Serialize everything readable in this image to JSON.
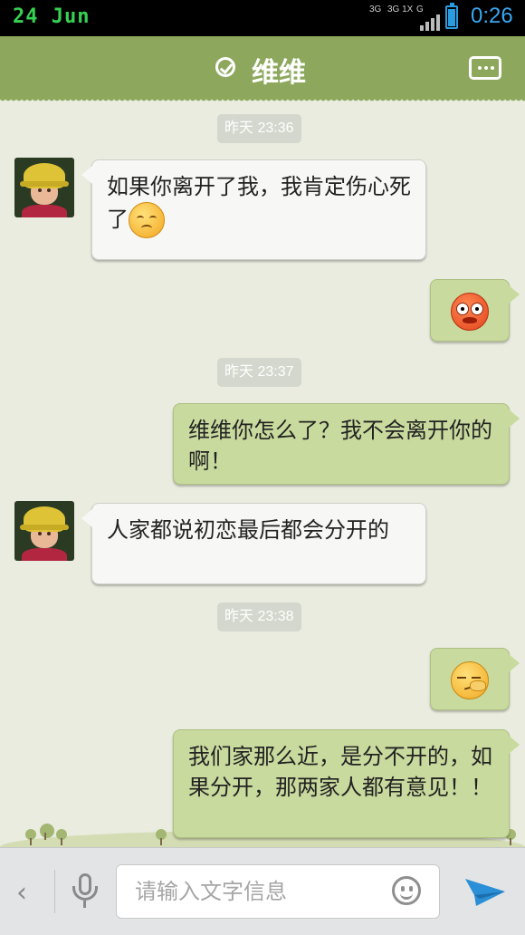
{
  "status_bar": {
    "date": "24 Jun",
    "network_labels": [
      "3G",
      "3G 1X",
      "G"
    ],
    "time": "0:26",
    "battery_level": 0.85
  },
  "header": {
    "title": "维维"
  },
  "timestamps": [
    "昨天 23:36",
    "昨天 23:37",
    "昨天 23:38"
  ],
  "messages": [
    {
      "side": "left",
      "text": "如果你离开了我，我肯定伤心死了",
      "emoji": "sad-face"
    },
    {
      "side": "right",
      "text": "",
      "emoji": "angry-face"
    },
    {
      "side": "right",
      "text": "维维你怎么了？我不会离开你的啊！"
    },
    {
      "side": "left",
      "text": "人家都说初恋最后都会分开的"
    },
    {
      "side": "right",
      "text": "",
      "emoji": "thinking-face"
    },
    {
      "side": "right",
      "text": "我们家那么近，是分不开的，如果分开，那两家人都有意见！！"
    }
  ],
  "input_bar": {
    "placeholder": "请输入文字信息"
  },
  "colors": {
    "header": "#8da85d",
    "background": "#e9ecdf",
    "bubble_left": "#f7f7f5",
    "bubble_right": "#c9da9e",
    "send_accent": "#2a8fd6"
  }
}
